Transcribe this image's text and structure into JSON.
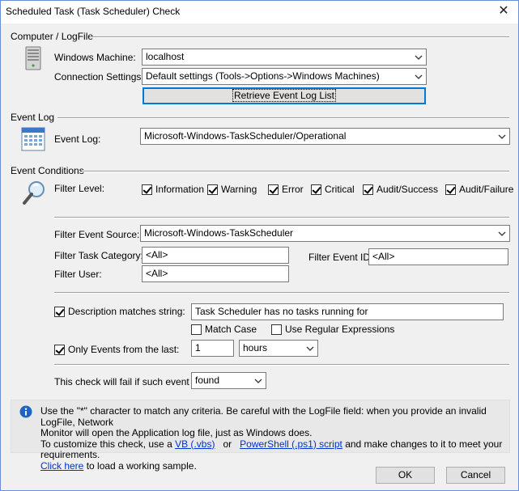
{
  "window": {
    "title": "Scheduled Task (Task Scheduler) Check",
    "close_glyph": "✕"
  },
  "computer_group": {
    "title": "Computer / LogFile",
    "icon": "computer-tower-icon",
    "machine_label": "Windows Machine:",
    "machine_value": "localhost",
    "connection_label": "Connection Settings:",
    "connection_value": "Default settings  (Tools->Options->Windows Machines)",
    "retrieve_button": "Retrieve Event Log List"
  },
  "event_log_group": {
    "title": "Event Log",
    "icon": "event-log-calendar-icon",
    "log_label": "Event Log:",
    "log_value": "Microsoft-Windows-TaskScheduler/Operational"
  },
  "conditions_group": {
    "title": "Event Conditions",
    "icon": "magnifier-icon",
    "filter_level_label": "Filter Level:",
    "levels": [
      {
        "label": "Information",
        "checked": true
      },
      {
        "label": "Warning",
        "checked": true
      },
      {
        "label": "Error",
        "checked": true
      },
      {
        "label": "Critical",
        "checked": true
      },
      {
        "label": "Audit/Success",
        "checked": true
      },
      {
        "label": "Audit/Failure",
        "checked": true
      }
    ],
    "source_label": "Filter Event Source:",
    "source_value": "Microsoft-Windows-TaskScheduler",
    "category_label": "Filter Task Category:",
    "category_value": "<All>",
    "event_id_label": "Filter Event ID:",
    "event_id_value": "<All>",
    "user_label": "Filter User:",
    "user_value": "<All>",
    "description_label": "Description matches string:",
    "description_checked": true,
    "description_value": "Task Scheduler has no tasks running for",
    "match_case_label": "Match Case",
    "match_case_checked": false,
    "regex_label": "Use Regular Expressions",
    "regex_checked": false,
    "only_events_label": "Only Events from the last:",
    "only_events_checked": true,
    "only_events_value": "1",
    "only_events_unit": "hours",
    "fail_label": "This check will fail if such event is",
    "fail_value": "found"
  },
  "info": {
    "icon": "info-icon",
    "line1": "Use the \"*\" character to match any criteria. Be careful with the LogFile field: when you provide an invalid LogFile, Network",
    "line2": "Monitor will open the Application log file, just as Windows does.",
    "line3_prefix": "To customize this check, use a",
    "vb_link": "VB (.vbs)",
    "or_text": "or",
    "ps_link": "PowerShell (.ps1) script",
    "line3_suffix": "and make changes to it to meet your requirements.",
    "click_here": "Click here",
    "line4_suffix": "to load a working sample."
  },
  "buttons": {
    "ok": "OK",
    "cancel": "Cancel"
  }
}
